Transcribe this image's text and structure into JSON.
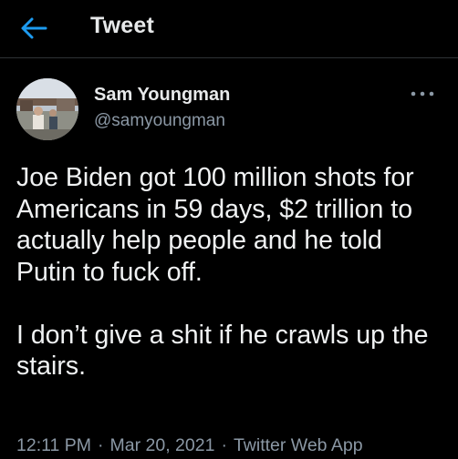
{
  "header": {
    "back_icon": "arrow-left-icon",
    "title": "Tweet"
  },
  "tweet": {
    "author": {
      "name": "Sam Youngman",
      "handle": "@samyoungman",
      "avatar_icon": "profile-photo"
    },
    "more_icon": "more-horizontal-icon",
    "text": "Joe Biden got 100 million shots for Americans in 59 days, $2 trillion to actually help people and he told Putin to fuck off.\n\nI don’t give a shit if he crawls up the stairs.",
    "meta": {
      "time": "12:11 PM",
      "separator": "·",
      "date": "Mar 20, 2021",
      "source": "Twitter Web App"
    }
  },
  "colors": {
    "background": "#000000",
    "accent": "#1d9bf0",
    "text_primary": "#e7e9ea",
    "text_secondary": "#8b98a5",
    "divider": "#2f3336"
  }
}
